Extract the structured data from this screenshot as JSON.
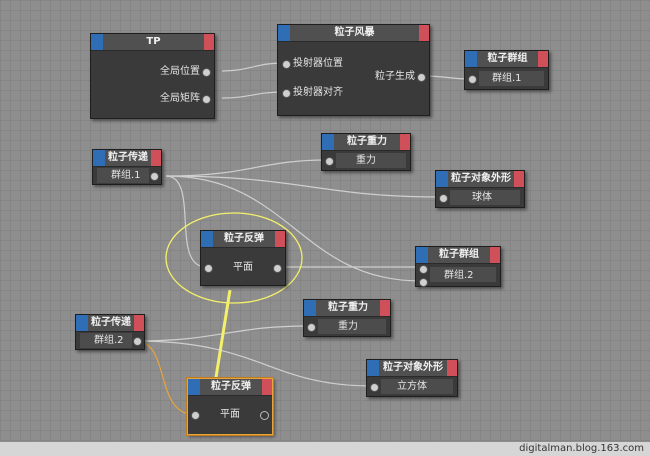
{
  "nodes": {
    "tp": {
      "title": "TP",
      "outputs": [
        "全局位置",
        "全局矩阵"
      ]
    },
    "emitter": {
      "title": "粒子风暴",
      "inputs": [
        "投射器位置",
        "投射器对齐"
      ],
      "output": "粒子生成"
    },
    "group1": {
      "title": "粒子群组",
      "port": "群组.1"
    },
    "pass1": {
      "title": "粒子传递",
      "port": "群组.1"
    },
    "gravity1": {
      "title": "粒子重力",
      "port": "重力"
    },
    "shape1": {
      "title": "粒子对象外形",
      "port": "球体"
    },
    "deflect1": {
      "title": "粒子反弹",
      "port": "平面"
    },
    "group2": {
      "title": "粒子群组",
      "port": "群组.2"
    },
    "pass2": {
      "title": "粒子传递",
      "port": "群组.2"
    },
    "gravity2": {
      "title": "粒子重力",
      "port": "重力"
    },
    "shape2": {
      "title": "粒子对象外形",
      "port": "立方体"
    },
    "deflect2": {
      "title": "粒子反弹",
      "port": "平面"
    }
  },
  "colors": {
    "header_left": "#2f6db5",
    "header_right": "#d0505a",
    "annotation": "#f4f06a",
    "selection": "#e8a33a"
  },
  "watermark": "digitalman.blog.163.com"
}
